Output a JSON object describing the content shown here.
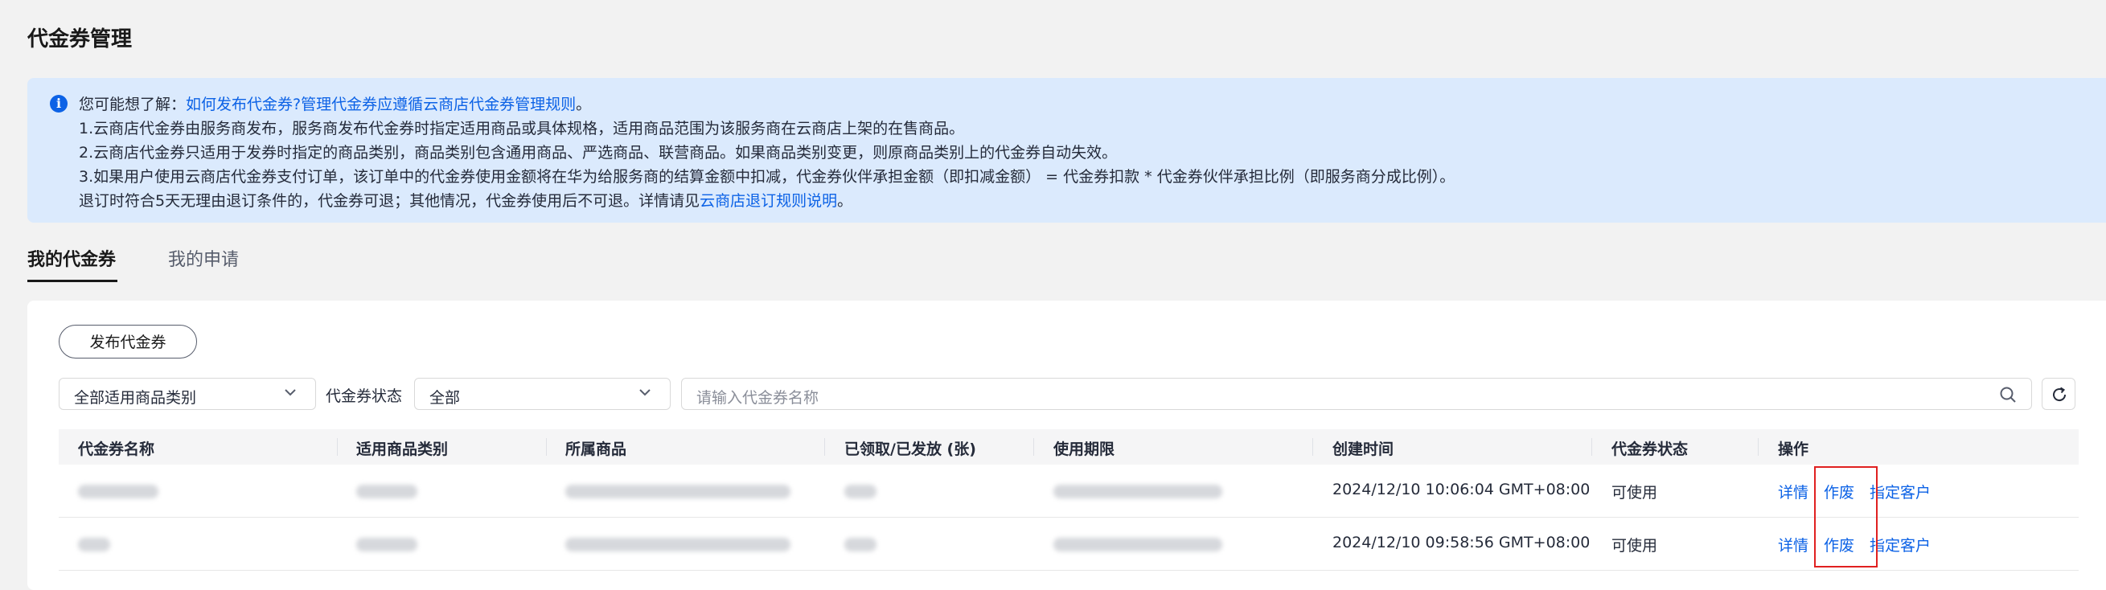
{
  "page": {
    "title": "代金券管理"
  },
  "notice": {
    "prefix": "您可能想了解：",
    "link1": "如何发布代金券?",
    "link2": "管理代金券应遵循云商店代金券管理规则",
    "link2_suffix": "。",
    "line1": "1.云商店代金券由服务商发布，服务商发布代金券时指定适用商品或具体规格，适用商品范围为该服务商在云商店上架的在售商品。",
    "line2": "2.云商店代金券只适用于发券时指定的商品类别，商品类别包含通用商品、严选商品、联营商品。如果商品类别变更，则原商品类别上的代金券自动失效。",
    "line3": "3.如果用户使用云商店代金券支付订单，该订单中的代金券使用金额将在华为给服务商的结算金额中扣减，代金券伙伴承担金额（即扣减金额） = 代金券扣款 * 代金券伙伴承担比例（即服务商分成比例）。",
    "line4_prefix": "退订时符合5天无理由退订条件的，代金券可退；其他情况，代金券使用后不可退。详情请见",
    "line4_link": "云商店退订规则说明",
    "line4_suffix": "。"
  },
  "tabs": [
    {
      "label": "我的代金券",
      "active": true
    },
    {
      "label": "我的申请",
      "active": false
    }
  ],
  "toolbar": {
    "publish_label": "发布代金券",
    "category_select": "全部适用商品类别",
    "status_label": "代金券状态",
    "status_select": "全部",
    "search_placeholder": "请输入代金券名称"
  },
  "table": {
    "columns": [
      "代金券名称",
      "适用商品类别",
      "所属商品",
      "已领取/已发放 (张)",
      "使用期限",
      "创建时间",
      "代金券状态",
      "操作"
    ],
    "rows": [
      {
        "created": "2024/12/10 10:06:04 GMT+08:00",
        "status": "可使用",
        "actions": [
          "详情",
          "作废",
          "指定客户"
        ]
      },
      {
        "created": "2024/12/10 09:58:56 GMT+08:00",
        "status": "可使用",
        "actions": [
          "详情",
          "作废",
          "指定客户"
        ]
      }
    ]
  },
  "colors": {
    "accent": "#0c62e6",
    "highlight": "#e02020",
    "notice_bg": "#dbeafd"
  },
  "icons": [
    "info-icon",
    "chevron-down-icon",
    "search-icon",
    "refresh-icon"
  ]
}
